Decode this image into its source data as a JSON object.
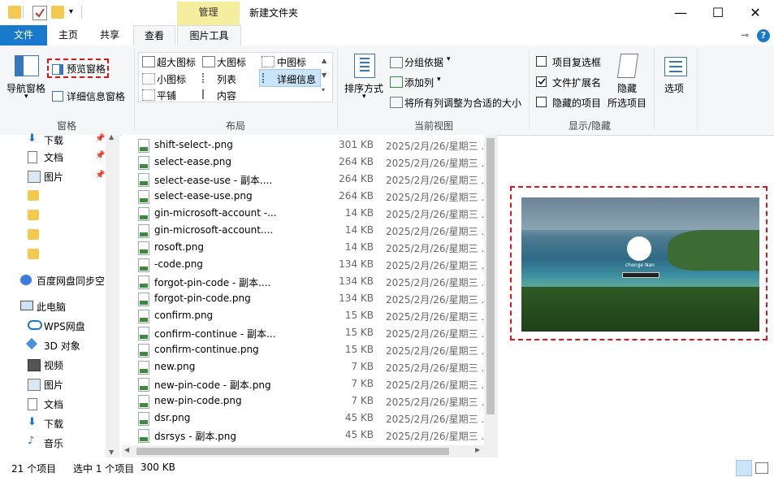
{
  "titlebar": {
    "manage_tab": "管理",
    "title": "新建文件夹",
    "minimize": "—",
    "maximize": "☐",
    "close": "✕"
  },
  "tabs": {
    "file": "文件",
    "home": "主页",
    "share": "共享",
    "view": "查看",
    "picture_tools": "图片工具"
  },
  "ribbon": {
    "panes": {
      "title": "窗格",
      "nav_pane": "导航窗格",
      "preview_pane": "预览窗格",
      "details_pane": "详细信息窗格"
    },
    "layout": {
      "title": "布局",
      "items": [
        "超大图标",
        "大图标",
        "中图标",
        "小图标",
        "列表",
        "详细信息",
        "平铺",
        "内容"
      ]
    },
    "current_view": {
      "title": "当前视图",
      "sort_by": "排序方式",
      "group_by": "分组依据",
      "add_column": "添加列",
      "size_all_columns": "将所有列调整为合适的大小"
    },
    "show_hide": {
      "title": "显示/隐藏",
      "item_checkboxes": "项目复选框",
      "file_extensions": "文件扩展名",
      "hidden_items": "隐藏的项目",
      "hide_selected": [
        "隐藏",
        "所选项目"
      ],
      "options": "选项"
    },
    "checkbox_states": {
      "item_checkboxes": false,
      "file_extensions": true,
      "hidden_items": false
    }
  },
  "nav": {
    "quick": [
      {
        "label": "下载",
        "pinned": true
      },
      {
        "label": "文档",
        "pinned": true
      },
      {
        "label": "图片",
        "pinned": true
      },
      {
        "label": ""
      },
      {
        "label": ""
      },
      {
        "label": ""
      },
      {
        "label": ""
      }
    ],
    "baidu": "百度网盘同步空",
    "this_pc": "此电脑",
    "pc_items": [
      "WPS网盘",
      "3D 对象",
      "视频",
      "图片",
      "文档",
      "下载",
      "音乐"
    ]
  },
  "files": [
    {
      "name": "shift-select-.png",
      "size": "301 KB",
      "date": "2025/2月/26/星期三 ..."
    },
    {
      "name": "select-ease.png",
      "size": "264 KB",
      "date": "2025/2月/26/星期三 ..."
    },
    {
      "name": "select-ease-use - 副本....",
      "size": "264 KB",
      "date": "2025/2月/26/星期三 ..."
    },
    {
      "name": "select-ease-use.png",
      "size": "264 KB",
      "date": "2025/2月/26/星期三 ..."
    },
    {
      "name": "gin-microsoft-account -...",
      "size": "14 KB",
      "date": "2025/2月/26/星期三 ..."
    },
    {
      "name": "gin-microsoft-account....",
      "size": "14 KB",
      "date": "2025/2月/26/星期三 ..."
    },
    {
      "name": "rosoft.png",
      "size": "14 KB",
      "date": "2025/2月/26/星期三 ..."
    },
    {
      "name": "-code.png",
      "size": "134 KB",
      "date": "2025/2月/26/星期三 ..."
    },
    {
      "name": "forgot-pin-code - 副本....",
      "size": "134 KB",
      "date": "2025/2月/26/星期三 ..."
    },
    {
      "name": "forgot-pin-code.png",
      "size": "134 KB",
      "date": "2025/2月/26/星期三 ..."
    },
    {
      "name": "confirm.png",
      "size": "15 KB",
      "date": "2025/2月/26/星期三 ..."
    },
    {
      "name": "confirm-continue - 副本...",
      "size": "15 KB",
      "date": "2025/2月/26/星期三 ..."
    },
    {
      "name": "confirm-continue.png",
      "size": "15 KB",
      "date": "2025/2月/26/星期三 ..."
    },
    {
      "name": "new.png",
      "size": "7 KB",
      "date": "2025/2月/26/星期三 ..."
    },
    {
      "name": "new-pin-code - 副本.png",
      "size": "7 KB",
      "date": "2025/2月/26/星期三 ..."
    },
    {
      "name": "new-pin-code.png",
      "size": "7 KB",
      "date": "2025/2月/26/星期三 ..."
    },
    {
      "name": "dsr.png",
      "size": "45 KB",
      "date": "2025/2月/26/星期三 ..."
    },
    {
      "name": "dsrsys - 副本.png",
      "size": "45 KB",
      "date": "2025/2月/26/星期三 ..."
    }
  ],
  "preview": {
    "user_name": "chenge Nan"
  },
  "status": {
    "count": "21 个项目",
    "selected": "选中 1 个项目",
    "size": "300 KB"
  },
  "colors": {
    "accent": "#1979ca",
    "manage_tab": "#f6ee9f",
    "highlight_outline": "#e0131a"
  }
}
